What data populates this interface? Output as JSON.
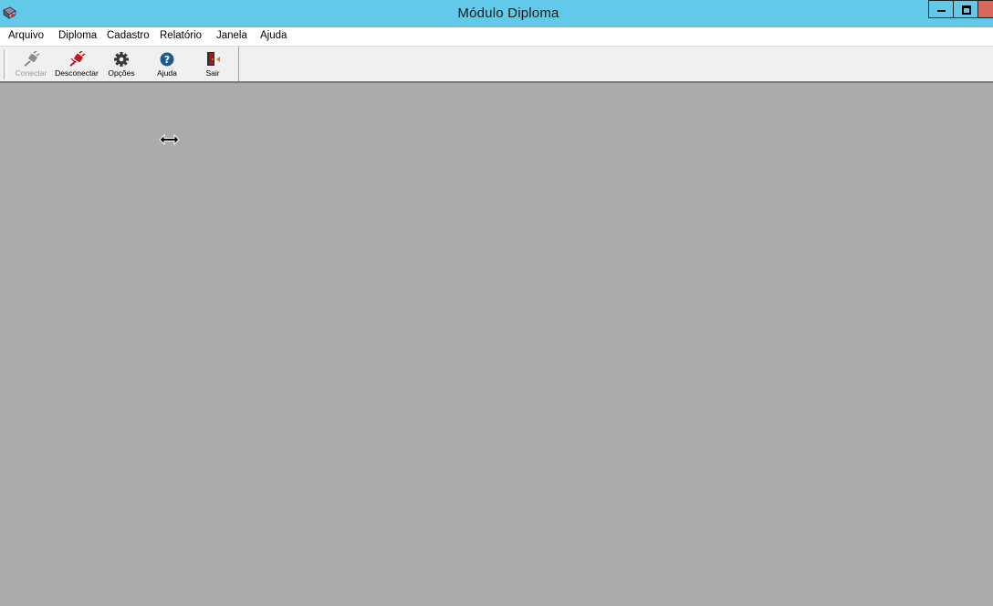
{
  "window": {
    "title": "Módulo Diploma",
    "icon": "app-diploma-icon",
    "controls": {
      "minimize": "minimize-icon",
      "maximize": "maximize-icon",
      "close": "close-icon"
    }
  },
  "menu": {
    "items": [
      "Arquivo",
      "Diploma",
      "Cadastro",
      "Relatório",
      "Janela",
      "Ajuda"
    ]
  },
  "toolbar": {
    "buttons": [
      {
        "label": "Conectar",
        "icon": "plug-connect-icon",
        "enabled": false
      },
      {
        "label": "Desconectar",
        "icon": "plug-disconnect-icon",
        "enabled": true
      },
      {
        "label": "Opções",
        "icon": "gear-icon",
        "enabled": true
      },
      {
        "label": "Ajuda",
        "icon": "help-icon",
        "enabled": true
      },
      {
        "label": "Sair",
        "icon": "exit-door-icon",
        "enabled": true
      }
    ]
  },
  "colors": {
    "titlebar": "#63c9e9",
    "close_button": "#d9675c",
    "workspace": "#ababab",
    "toolbar": "#f0f0f0",
    "disconnect_red": "#c8141e",
    "help_blue": "#1d5b8c"
  },
  "cursor": "horizontal-resize-cursor-icon"
}
